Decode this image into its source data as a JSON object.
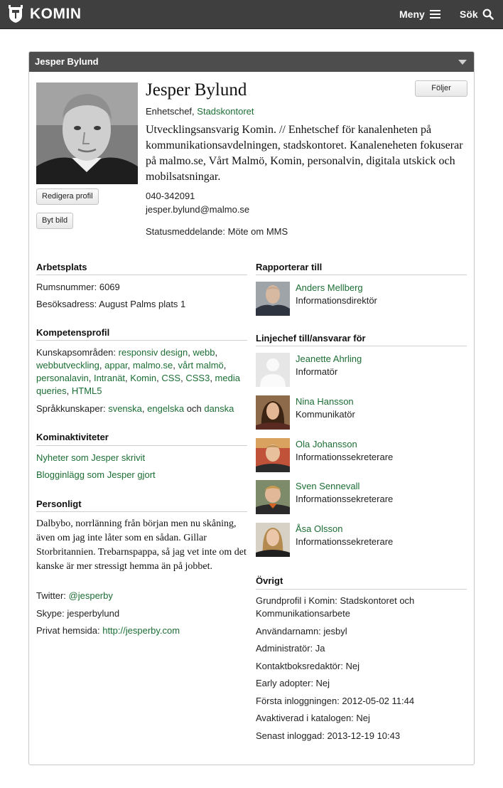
{
  "header": {
    "logo_text": "KOMIN",
    "menu_label": "Meny",
    "search_label": "Sök",
    "bg_color": "#3f3f3f"
  },
  "panel": {
    "title": "Jesper Bylund"
  },
  "profile": {
    "name": "Jesper Bylund",
    "title_prefix": "Enhetschef,",
    "department": "Stadskontoret",
    "bio": "Utvecklingsansvarig Komin. // Enhetschef för kanalenheten på kommunikationsavdelningen, stadskontoret. Kanaleneheten fokuserar på malmo.se, Vårt Malmö, Komin, personalvin, digitala utskick och mobilsatsningar.",
    "phone": "040-342091",
    "email": "jesper.bylund@malmo.se",
    "status": "Statusmeddelande: Möte om MMS",
    "follow_button": "Följer",
    "edit_button": "Redigera profil",
    "change_picture_button": "Byt bild"
  },
  "workplace": {
    "heading": "Arbetsplats",
    "room": "Rumsnummer: 6069",
    "address": "Besöksadress: August Palms plats 1"
  },
  "competence": {
    "heading": "Kompetensprofil",
    "areas_label": "Kunskapsområden:",
    "areas": [
      "responsiv design",
      "webb",
      "webbutveckling",
      "appar",
      "malmo.se",
      "vårt malmö",
      "personalavin",
      "Intranät",
      "Komin",
      "CSS",
      "CSS3",
      "media queries",
      "HTML5"
    ],
    "languages_label": "Språkkunskaper:",
    "languages": [
      "svenska",
      "engelska",
      "danska"
    ],
    "languages_joiner": "och"
  },
  "activities": {
    "heading": "Kominaktiviteter",
    "news_link": "Nyheter som Jesper skrivit",
    "blog_link": "Blogginlägg som Jesper gjort"
  },
  "personal": {
    "heading": "Personligt",
    "text": "Dalbybo, norrlänning från början men nu skåning, även om jag inte låter som en sådan. Gillar Storbritannien. Trebarnspappa, så jag vet inte om det kanske är mer stressigt hemma än på jobbet.",
    "twitter_label": "Twitter:",
    "twitter": "@jesperby",
    "skype": "Skype: jesperbylund",
    "homepage_label": "Privat hemsida:",
    "homepage": "http://jesperby.com"
  },
  "reports_to": {
    "heading": "Rapporterar till",
    "person": {
      "name": "Anders Mellberg",
      "title": "Informationsdirektör"
    }
  },
  "manages": {
    "heading": "Linjechef till/ansvarar för",
    "people": [
      {
        "name": "Jeanette Ahrling",
        "title": "Informatör"
      },
      {
        "name": "Nina Hansson",
        "title": "Kommunikatör"
      },
      {
        "name": "Ola Johansson",
        "title": "Informationssekreterare"
      },
      {
        "name": "Sven Sennevall",
        "title": "Informationssekreterare"
      },
      {
        "name": "Åsa Olsson",
        "title": "Informationssekreterare"
      }
    ]
  },
  "other": {
    "heading": "Övrigt",
    "base_profile": "Grundprofil i Komin: Stadskontoret och Kommunikationsarbete",
    "username": "Användarnamn: jesbyl",
    "admin": "Administratör: Ja",
    "contact_editor": "Kontaktboksredaktör: Nej",
    "early_adopter": "Early adopter: Nej",
    "first_login": "Första inloggningen: 2012-05-02 11:44",
    "deactivated": "Avaktiverad i katalogen: Nej",
    "last_login": "Senast inloggad: 2013-12-19 10:43"
  },
  "colors": {
    "link": "#1c6e34",
    "panel_header": "#4d4d4d"
  }
}
